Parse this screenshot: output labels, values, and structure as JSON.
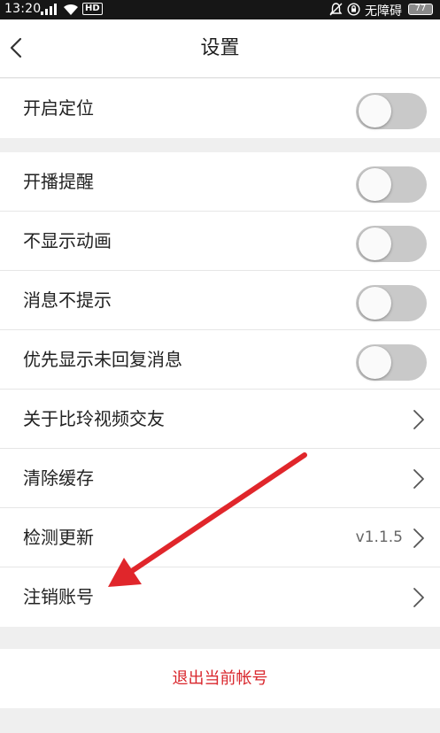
{
  "status_bar": {
    "time": "13:20",
    "network_label": "HD",
    "carrier": "无障碍",
    "battery": "77"
  },
  "header": {
    "title": "设置"
  },
  "group1": {
    "items": [
      {
        "label": "开启定位",
        "toggle_on": false
      }
    ]
  },
  "group2": {
    "items": [
      {
        "label": "开播提醒",
        "toggle_on": false
      },
      {
        "label": "不显示动画",
        "toggle_on": false
      },
      {
        "label": "消息不提示",
        "toggle_on": false
      },
      {
        "label": "优先显示未回复消息",
        "toggle_on": false
      },
      {
        "label": "关于比玲视频交友"
      },
      {
        "label": "清除缓存"
      },
      {
        "label": "检测更新",
        "value": "v1.1.5"
      },
      {
        "label": "注销账号"
      }
    ]
  },
  "logout_label": "退出当前帐号",
  "colors": {
    "accent": "#d9262c",
    "toggle_off": "#c9c9c9",
    "annotation_arrow": "#e0262b"
  }
}
